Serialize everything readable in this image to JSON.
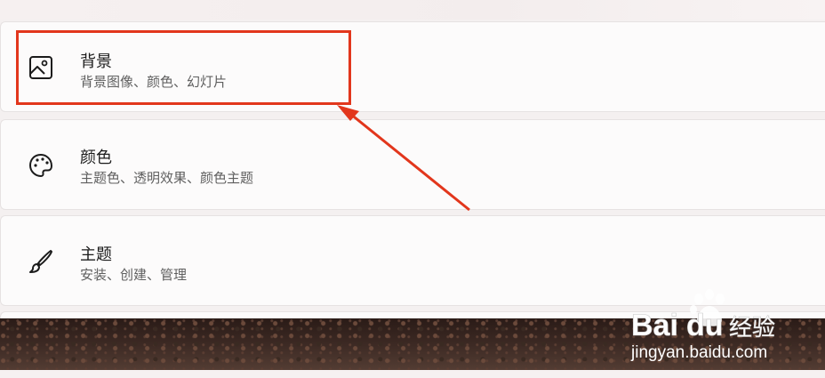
{
  "cards": [
    {
      "title": "背景",
      "subtitle": "背景图像、颜色、幻灯片",
      "icon": "picture-icon"
    },
    {
      "title": "颜色",
      "subtitle": "主题色、透明效果、颜色主题",
      "icon": "palette-icon"
    },
    {
      "title": "主题",
      "subtitle": "安装、创建、管理",
      "icon": "brush-icon"
    }
  ],
  "watermark": {
    "brand": "Bai",
    "brand2": "du",
    "tag": "经验",
    "url": "jingyan.baidu.com"
  },
  "colors": {
    "highlight": "#e2361c",
    "arrow": "#e2361c"
  }
}
